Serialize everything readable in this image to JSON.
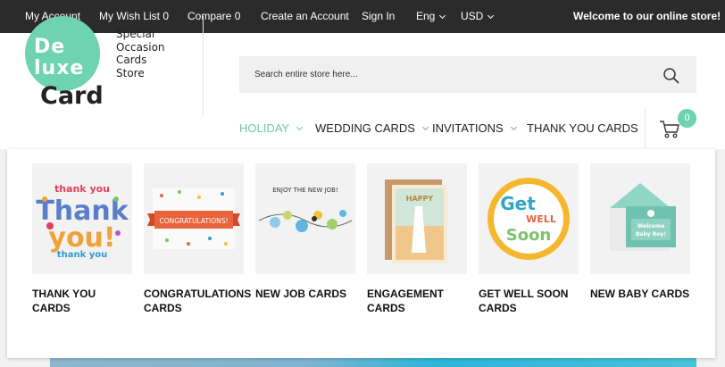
{
  "topbar": {
    "my_account": "My Account",
    "wish_list": "My Wish List 0",
    "compare": "Compare 0",
    "create_account": "Create an Account",
    "sign_in": "Sign In",
    "language": "Eng",
    "currency": "USD",
    "welcome": "Welcome to our online store!"
  },
  "logo": {
    "line1": "De",
    "line2": "luxe",
    "line3": "Card"
  },
  "tagline": [
    "Special",
    "Occasion",
    "Cards",
    "Store"
  ],
  "search": {
    "placeholder": "Search entire store here..."
  },
  "nav": [
    {
      "label": "HOLIDAY",
      "active": true
    },
    {
      "label": "WEDDING CARDS",
      "active": false
    },
    {
      "label": "INVITATIONS",
      "active": false
    },
    {
      "label": "THANK YOU CARDS",
      "active": false
    }
  ],
  "cart": {
    "count": "0"
  },
  "dropdown": {
    "cards": [
      {
        "label": "THANK YOU CARDS",
        "thumb_text": "Thank you"
      },
      {
        "label": "CONGRATULATIONS CARDS",
        "thumb_text": "CONGRATULATIONS!"
      },
      {
        "label": "NEW JOB CARDS",
        "thumb_text": "ENJOY THE NEW JOB!"
      },
      {
        "label": "ENGAGEMENT CARDS",
        "thumb_text": "HAPPY"
      },
      {
        "label": "GET WELL SOON CARDS",
        "thumb_text": "Get well soon"
      },
      {
        "label": "NEW BABY CARDS",
        "thumb_text": "Welcome Baby Boy!"
      }
    ]
  },
  "colors": {
    "topbar_bg": "#2b2b2b",
    "accent": "#6ed3b0",
    "nav_active": "#6ec8a8",
    "search_bg": "#f0f0f0"
  }
}
